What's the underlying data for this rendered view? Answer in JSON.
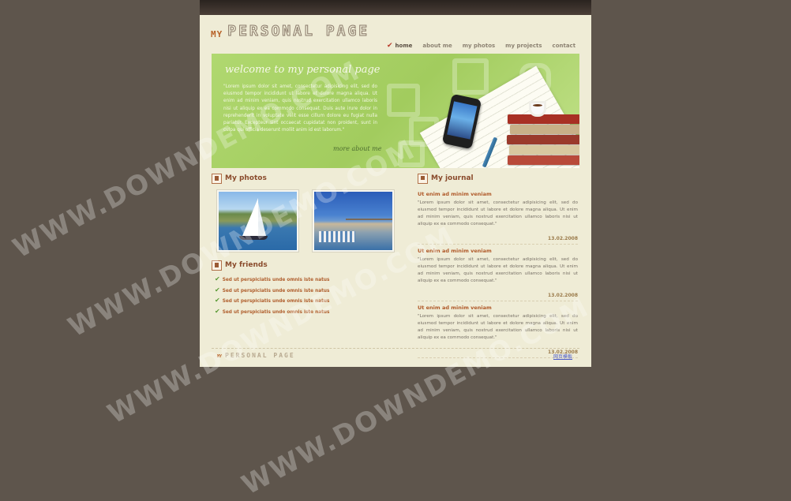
{
  "logo": {
    "prefix": "MY",
    "title": "PERSONAL  PAGE"
  },
  "nav": {
    "items": [
      {
        "label": "home",
        "active": true
      },
      {
        "label": "about me",
        "active": false
      },
      {
        "label": "my photos",
        "active": false
      },
      {
        "label": "my projects",
        "active": false
      },
      {
        "label": "contact",
        "active": false
      }
    ]
  },
  "banner": {
    "title": "welcome to my personal page",
    "text": "\"Lorem ipsum dolor sit amet, consectetur adipisicing elit, sed do eiusmod tempor incididunt ut labore et dolore magna aliqua. Ut enim ad minim veniam, quis nostrud exercitation ullamco laboris nisi ut aliquip ex ea commodo consequat. Duis aute irure dolor in reprehenderit in voluptate velit esse cillum dolore eu fugiat nulla pariatur. Excepteur sint occaecat cupidatat non proident, sunt in culpa qui officia deserunt mollit anim id est laborum.\"",
    "more_link": "more about me"
  },
  "photos": {
    "title": "My photos"
  },
  "friends": {
    "title": "My friends",
    "items": [
      "Sed ut perspiciatis unde omnis iste natus",
      "Sed ut perspiciatis unde omnis iste natus",
      "Sed ut perspiciatis unde omnis iste natus",
      "Sed ut perspiciatis unde omnis iste natus"
    ]
  },
  "journal": {
    "title": "My journal",
    "entries": [
      {
        "title": "Ut enim ad minim veniam",
        "text": "\"Lorem ipsum dolor sit amet, consectetur adipisicing elit, sed do eiusmod tempor incididunt ut labore et dolore magna aliqua. Ut enim ad minim veniam, quis nostrud exercitation ullamco laboris nisi ut aliquip ex ea commodo consequat.\"",
        "date": "13.02.2008"
      },
      {
        "title": "Ut enim ad minim veniam",
        "text": "\"Lorem ipsum dolor sit amet, consectetur adipisicing elit, sed do eiusmod tempor incididunt ut labore et dolore magna aliqua. Ut enim ad minim veniam, quis nostrud exercitation ullamco laboris nisi ut aliquip ex ea commodo consequat.\"",
        "date": "13.02.2008"
      },
      {
        "title": "Ut enim ad minim veniam",
        "text": "\"Lorem ipsum dolor sit amet, consectetur adipisicing elit, sed do eiusmod tempor incididunt ut labore et dolore magna aliqua. Ut enim ad minim veniam, quis nostrud exercitation ullamco laboris nisi ut aliquip ex ea commodo consequat.\"",
        "date": "13.02.2008"
      }
    ]
  },
  "footer": {
    "logo_prefix": "MY",
    "logo_title": "PERSONAL  PAGE",
    "link": "网页模板"
  },
  "watermark": {
    "text": "WWW.DOWNDEMO.COM"
  },
  "colors": {
    "background": "#5e554c",
    "page": "#efecd6",
    "banner": "#a2cc5e",
    "heading": "#8a4b2c",
    "accent": "#b05a2a"
  }
}
